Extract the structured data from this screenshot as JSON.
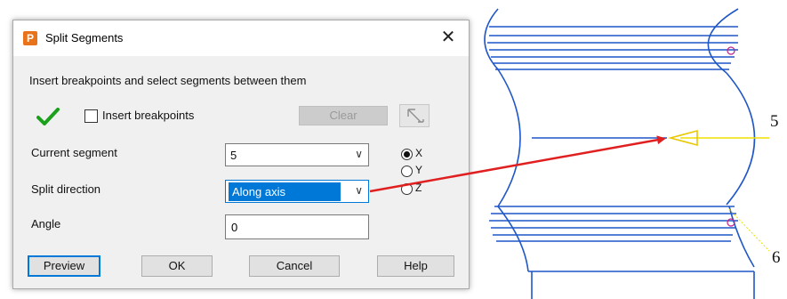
{
  "dialog": {
    "title": "Split Segments",
    "app_icon_letter": "P",
    "close_glyph": "✕",
    "instruction": "Insert breakpoints and select segments between them",
    "insert_breakpoints_label": "Insert breakpoints",
    "insert_breakpoints_checked": false,
    "clear_label": "Clear",
    "current_segment_label": "Current segment",
    "current_segment_value": "5",
    "split_direction_label": "Split direction",
    "split_direction_value": "Along axis",
    "axis_options": [
      "X",
      "Y",
      "Z"
    ],
    "axis_selected": "X",
    "angle_label": "Angle",
    "angle_value": "0",
    "buttons": {
      "preview": "Preview",
      "ok": "OK",
      "cancel": "Cancel",
      "help": "Help"
    }
  },
  "drawing": {
    "labels": [
      "5",
      "6"
    ],
    "line_color": "#1f56c8",
    "arrow_color": "#e02020",
    "marker_color": "#f0e000"
  }
}
